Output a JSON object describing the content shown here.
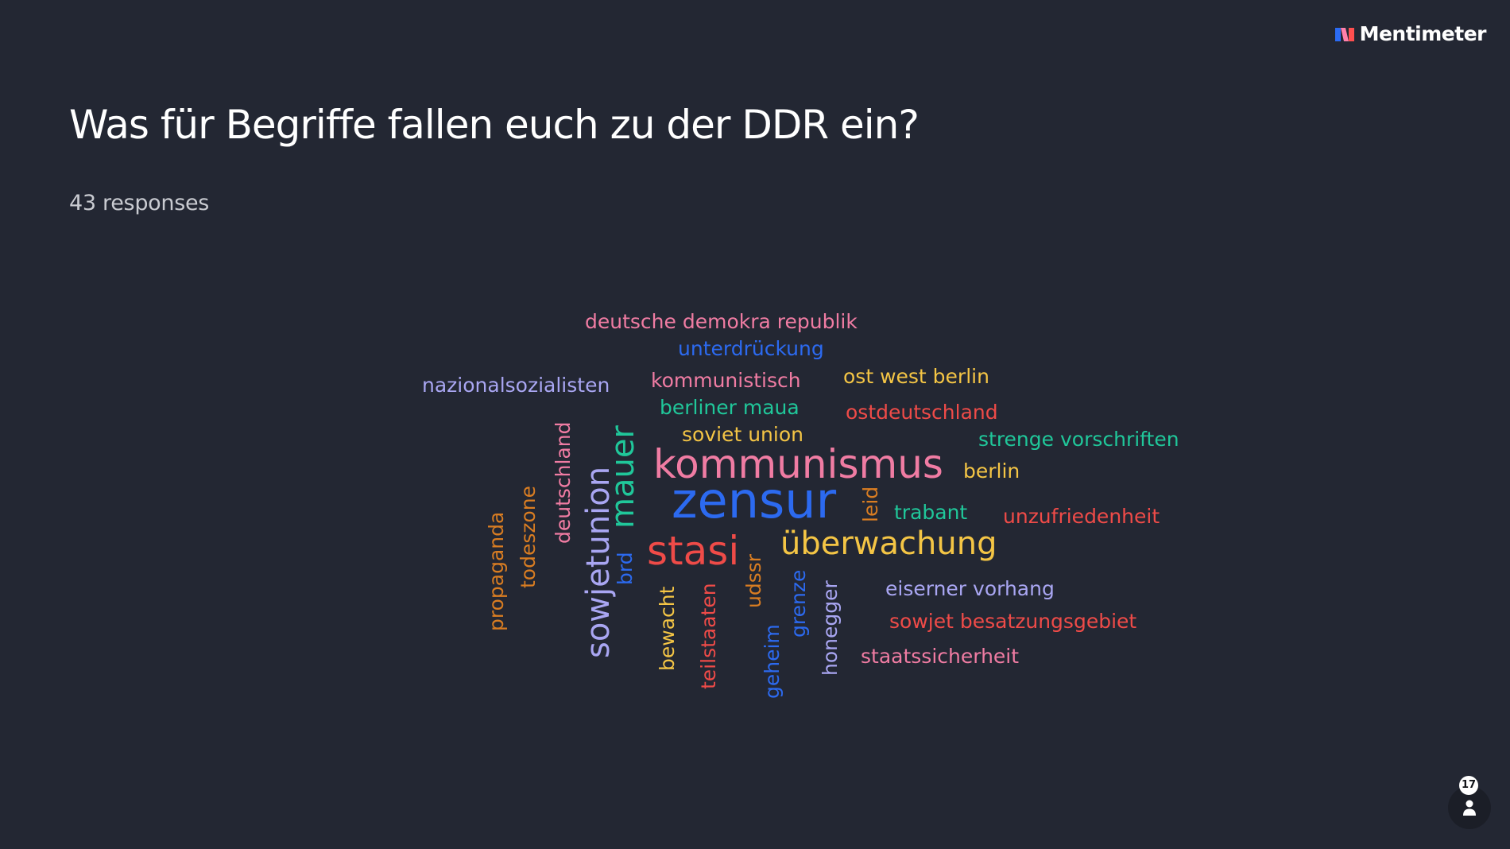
{
  "brand": {
    "name": "Mentimeter",
    "colors": {
      "blue": "#2B6BF3",
      "pink": "#FF80AB",
      "red": "#FF4F4F"
    }
  },
  "question": {
    "title": "Was für Begriffe fallen euch zu der DDR ein?",
    "responses_label": "43 responses"
  },
  "colors": {
    "background": "#232733",
    "palette": {
      "pink": "#F07CA3",
      "blue": "#2C6AF0",
      "lavender": "#A9A6F2",
      "yellow": "#F4C545",
      "red": "#EF4B48",
      "green": "#20C79A",
      "orange": "#D97D22"
    }
  },
  "wordcloud": [
    {
      "text": "deutsche demokra republik",
      "color": "pink",
      "weight": 1
    },
    {
      "text": "unterdrückung",
      "color": "blue",
      "weight": 1
    },
    {
      "text": "nazionalsozialisten",
      "color": "lavender",
      "weight": 1
    },
    {
      "text": "kommunistisch",
      "color": "pink",
      "weight": 1
    },
    {
      "text": "ost west berlin",
      "color": "yellow",
      "weight": 1
    },
    {
      "text": "berliner maua",
      "color": "green",
      "weight": 1
    },
    {
      "text": "ostdeutschland",
      "color": "red",
      "weight": 1
    },
    {
      "text": "soviet union",
      "color": "yellow",
      "weight": 1
    },
    {
      "text": "strenge vorschriften",
      "color": "green",
      "weight": 1
    },
    {
      "text": "kommunismus",
      "color": "pink",
      "weight": 3
    },
    {
      "text": "berlin",
      "color": "yellow",
      "weight": 1
    },
    {
      "text": "zensur",
      "color": "blue",
      "weight": 5
    },
    {
      "text": "trabant",
      "color": "green",
      "weight": 1
    },
    {
      "text": "unzufriedenheit",
      "color": "red",
      "weight": 1
    },
    {
      "text": "stasi",
      "color": "red",
      "weight": 3
    },
    {
      "text": "überwachung",
      "color": "yellow",
      "weight": 2
    },
    {
      "text": "eiserner vorhang",
      "color": "lavender",
      "weight": 1
    },
    {
      "text": "sowjet besatzungsgebiet",
      "color": "red",
      "weight": 1
    },
    {
      "text": "staatssicherheit",
      "color": "pink",
      "weight": 1
    },
    {
      "text": "deutschland",
      "color": "pink",
      "weight": 1
    },
    {
      "text": "mauer",
      "color": "green",
      "weight": 2
    },
    {
      "text": "sowjetunion",
      "color": "lavender",
      "weight": 2
    },
    {
      "text": "todeszone",
      "color": "orange",
      "weight": 1
    },
    {
      "text": "propaganda",
      "color": "orange",
      "weight": 1
    },
    {
      "text": "brd",
      "color": "blue",
      "weight": 1
    },
    {
      "text": "leid",
      "color": "orange",
      "weight": 1
    },
    {
      "text": "bewacht",
      "color": "yellow",
      "weight": 1
    },
    {
      "text": "teilstaaten",
      "color": "red",
      "weight": 1
    },
    {
      "text": "udssr",
      "color": "orange",
      "weight": 1
    },
    {
      "text": "geheim",
      "color": "blue",
      "weight": 1
    },
    {
      "text": "grenze",
      "color": "blue",
      "weight": 1
    },
    {
      "text": "honegger",
      "color": "lavender",
      "weight": 1
    }
  ],
  "participants": {
    "count": "17",
    "icon": "person-icon"
  }
}
